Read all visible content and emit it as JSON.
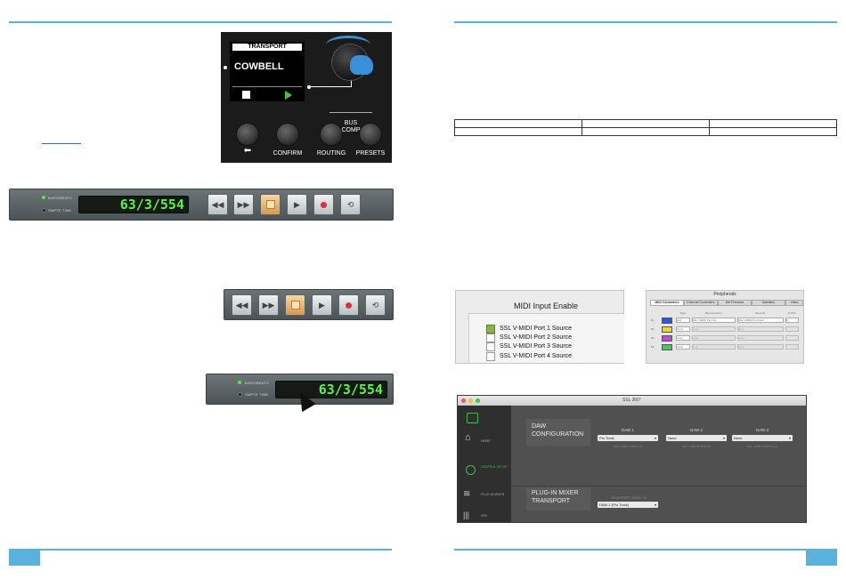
{
  "panel": {
    "screen_title": "TRANSPORT",
    "screen_name": "COWBELL",
    "bus_comp_line1": "BUS",
    "bus_comp_line2": "COMP",
    "buttons": {
      "back": "⬅",
      "confirm": "CONFIRM",
      "routing": "ROUTING",
      "presets": "PRESETS"
    }
  },
  "transport": {
    "label_bars": "BARS/BEATS",
    "label_smpte": "SMPTE TIME",
    "counter": "63/3/554",
    "led_on_color": "#5de15a"
  },
  "midi_window": {
    "title": "MIDI Input Enable",
    "items": [
      {
        "label": "SSL V-MIDI Port 1 Source",
        "checked": true
      },
      {
        "label": "SSL V-MIDI Port 2 Source",
        "checked": false
      },
      {
        "label": "SSL V-MIDI Port 3 Source",
        "checked": false
      },
      {
        "label": "SSL V-MIDI Port 4 Source",
        "checked": false
      }
    ]
  },
  "peripherals": {
    "title": "Peripherals",
    "tabs": [
      "MIDI Controllers",
      "Ethernet Controllers",
      "Mix Previews",
      "Satellites",
      "Video"
    ],
    "headers": [
      "Type",
      "Receive From",
      "Send To",
      "# Ch's"
    ],
    "rows": [
      {
        "num": "#1",
        "color": "#2f55e0",
        "type": "HUI",
        "receive": "SSL V-MIDI Port Src",
        "send": "SSL V-MIDI Port Dest",
        "ch": "8"
      },
      {
        "num": "#2",
        "color": "#f1d13a",
        "type": "none",
        "receive": "none",
        "send": "none",
        "ch": ""
      },
      {
        "num": "#3",
        "color": "#b64fd6",
        "type": "none",
        "receive": "none",
        "send": "none",
        "ch": ""
      },
      {
        "num": "#4",
        "color": "#47c45a",
        "type": "none",
        "receive": "none",
        "send": "none",
        "ch": ""
      }
    ]
  },
  "ssl360": {
    "title": "SSL 360°",
    "sidebar": [
      {
        "label": "HOME",
        "icon": "home-icon"
      },
      {
        "label": "CONTROL SETUP",
        "icon": "control-setup-icon"
      },
      {
        "label": "PLUG-IN MIXER",
        "icon": "plugin-mixer-icon"
      },
      {
        "label": "UF8",
        "icon": "uf8-icon"
      }
    ],
    "daw_section_line1": "DAW",
    "daw_section_line2": "CONFIGURATION",
    "daws": [
      {
        "label": "DAW 1",
        "value": "Pro Tools",
        "sub": "SSL V-MIDI PORTS 1-4"
      },
      {
        "label": "DAW 2",
        "value": "None",
        "sub": "SSL V-MIDI PORTS 5-8"
      },
      {
        "label": "DAW 3",
        "value": "None",
        "sub": "SSL V-MIDI PORTS 9-12"
      }
    ],
    "plugin_section_line1": "PLUG-IN MIXER",
    "plugin_section_line2": "TRANSPORT",
    "transport_linked_label": "TRANSPORT LINKED TO",
    "transport_linked_value": "DAW 1 (Pro Tools)"
  }
}
